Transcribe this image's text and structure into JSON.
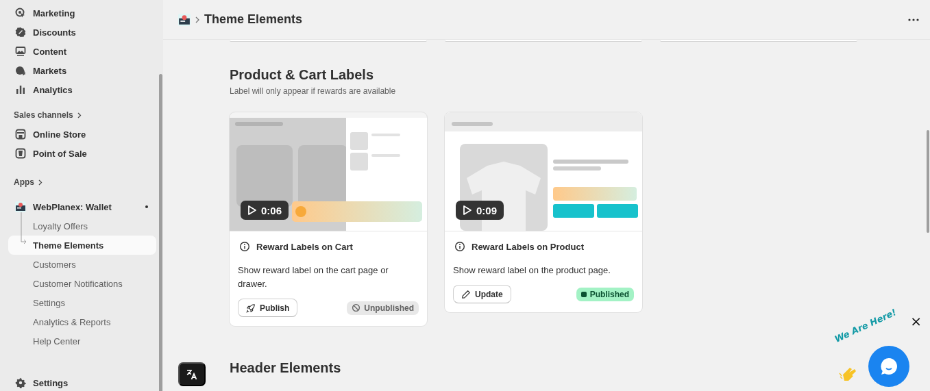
{
  "sidebar": {
    "items": [
      {
        "label": "Marketing"
      },
      {
        "label": "Discounts"
      },
      {
        "label": "Content"
      },
      {
        "label": "Markets"
      },
      {
        "label": "Analytics"
      }
    ],
    "sales_channels": {
      "label": "Sales channels",
      "items": [
        {
          "label": "Online Store"
        },
        {
          "label": "Point of Sale"
        }
      ]
    },
    "apps": {
      "label": "Apps"
    },
    "app": {
      "label": "WebPlanex: Wallet",
      "children": [
        {
          "label": "Loyalty Offers",
          "selected": false
        },
        {
          "label": "Theme Elements",
          "selected": true
        },
        {
          "label": "Customers",
          "selected": false
        },
        {
          "label": "Customer Notifications",
          "selected": false
        },
        {
          "label": "Settings",
          "selected": false
        },
        {
          "label": "Analytics & Reports",
          "selected": false
        },
        {
          "label": "Help Center",
          "selected": false
        }
      ]
    },
    "settings": {
      "label": "Settings"
    }
  },
  "header": {
    "title": "Theme Elements"
  },
  "section": {
    "title": "Product & Cart Labels",
    "subtitle": "Label will only appear if rewards are available",
    "cards": [
      {
        "kind": "cart",
        "duration": "0:06",
        "title": "Reward Labels on Cart",
        "description": "Show reward label on the cart page or drawer.",
        "button": {
          "kind": "publish",
          "label": "Publish"
        },
        "status": {
          "label": "Unpublished",
          "published": false
        }
      },
      {
        "kind": "product",
        "duration": "0:09",
        "title": "Reward Labels on Product",
        "description": "Show reward label on the product page.",
        "button": {
          "kind": "update",
          "label": "Update"
        },
        "status": {
          "label": "Published",
          "published": true
        }
      }
    ]
  },
  "next_section": {
    "title": "Header Elements"
  },
  "chat_widget": {
    "greeting": "We Are Here!",
    "close": "×"
  }
}
